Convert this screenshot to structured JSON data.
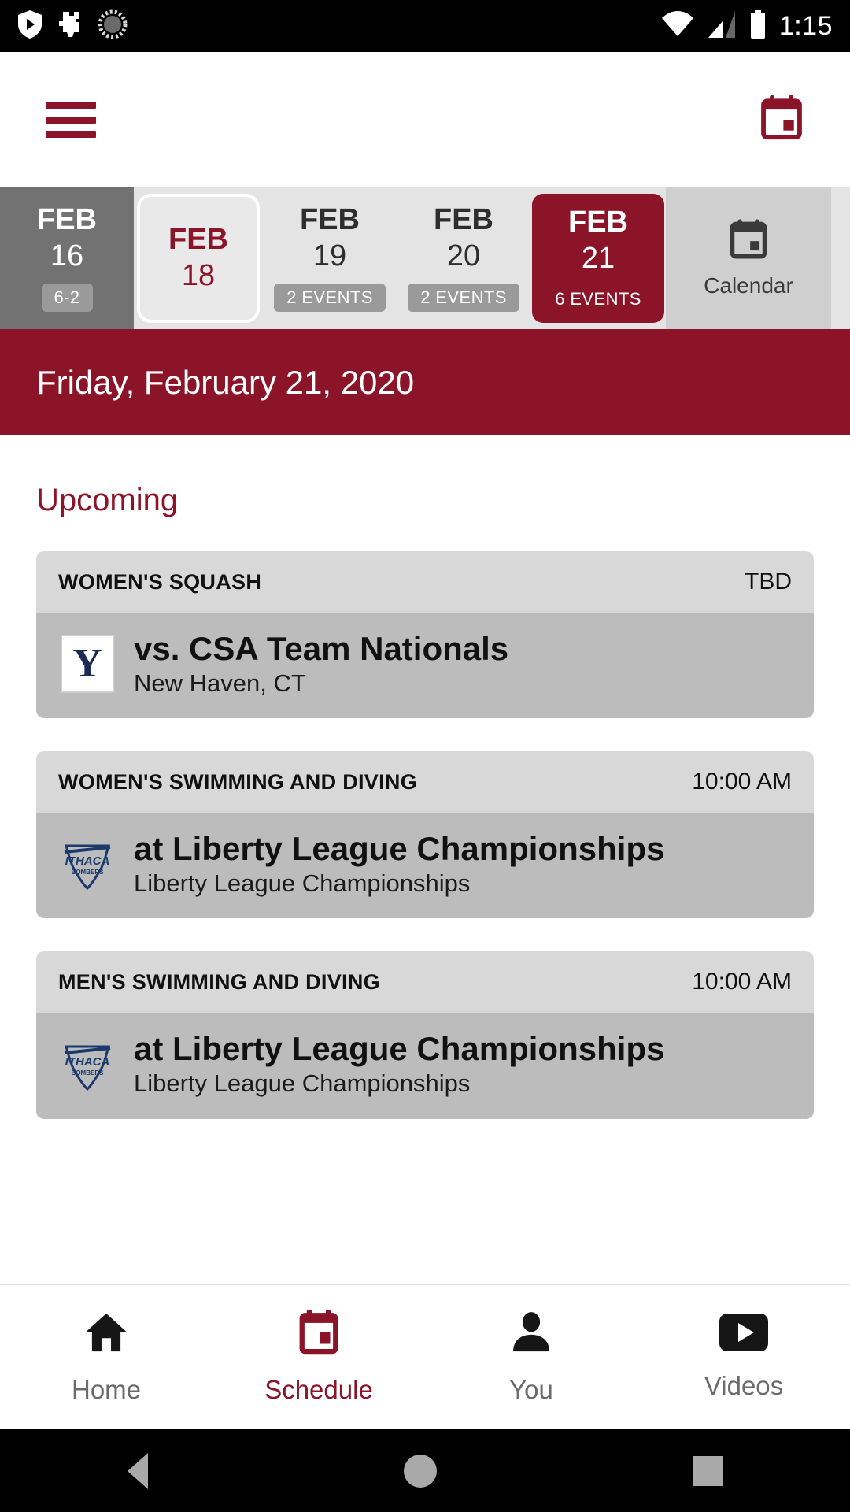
{
  "status_bar": {
    "time": "1:15",
    "icons": [
      "shield-play-icon",
      "puzzle-icon",
      "loading-icon",
      "wifi-icon",
      "cell-signal-icon",
      "battery-icon"
    ]
  },
  "app_bar": {
    "menu_icon": "hamburger-menu-icon",
    "calendar_icon": "calendar-icon",
    "accent_color": "#8C1429"
  },
  "date_tabs": [
    {
      "month": "FEB",
      "day": "16",
      "badge": "6-2",
      "state": "past"
    },
    {
      "month": "FEB",
      "day": "18",
      "badge": "",
      "state": "today"
    },
    {
      "month": "FEB",
      "day": "19",
      "badge": "2 EVENTS",
      "state": "normal"
    },
    {
      "month": "FEB",
      "day": "20",
      "badge": "2 EVENTS",
      "state": "normal"
    },
    {
      "month": "FEB",
      "day": "21",
      "badge": "6 EVENTS",
      "state": "selected"
    }
  ],
  "calendar_tab": {
    "label": "Calendar",
    "icon": "calendar-icon"
  },
  "date_header": {
    "text": "Friday, February 21, 2020"
  },
  "section": {
    "title": "Upcoming"
  },
  "events": [
    {
      "sport": "WOMEN'S SQUASH",
      "time": "TBD",
      "opponent": "vs. CSA Team Nationals",
      "location": "New Haven, CT",
      "logo": "yale-logo"
    },
    {
      "sport": "WOMEN'S SWIMMING AND DIVING",
      "time": "10:00 AM",
      "opponent": "at Liberty League Championships",
      "location": "Liberty League Championships",
      "logo": "ithaca-bombers-logo"
    },
    {
      "sport": "MEN'S SWIMMING AND DIVING",
      "time": "10:00 AM",
      "opponent": "at Liberty League Championships",
      "location": "Liberty League Championships",
      "logo": "ithaca-bombers-logo"
    }
  ],
  "bottom_nav": [
    {
      "label": "Home",
      "icon": "home-icon",
      "active": false
    },
    {
      "label": "Schedule",
      "icon": "calendar-icon",
      "active": true
    },
    {
      "label": "You",
      "icon": "person-icon",
      "active": false
    },
    {
      "label": "Videos",
      "icon": "video-play-icon",
      "active": false
    }
  ],
  "system_nav": {
    "back": "back-triangle-icon",
    "home": "home-circle-icon",
    "recents": "recents-square-icon"
  }
}
